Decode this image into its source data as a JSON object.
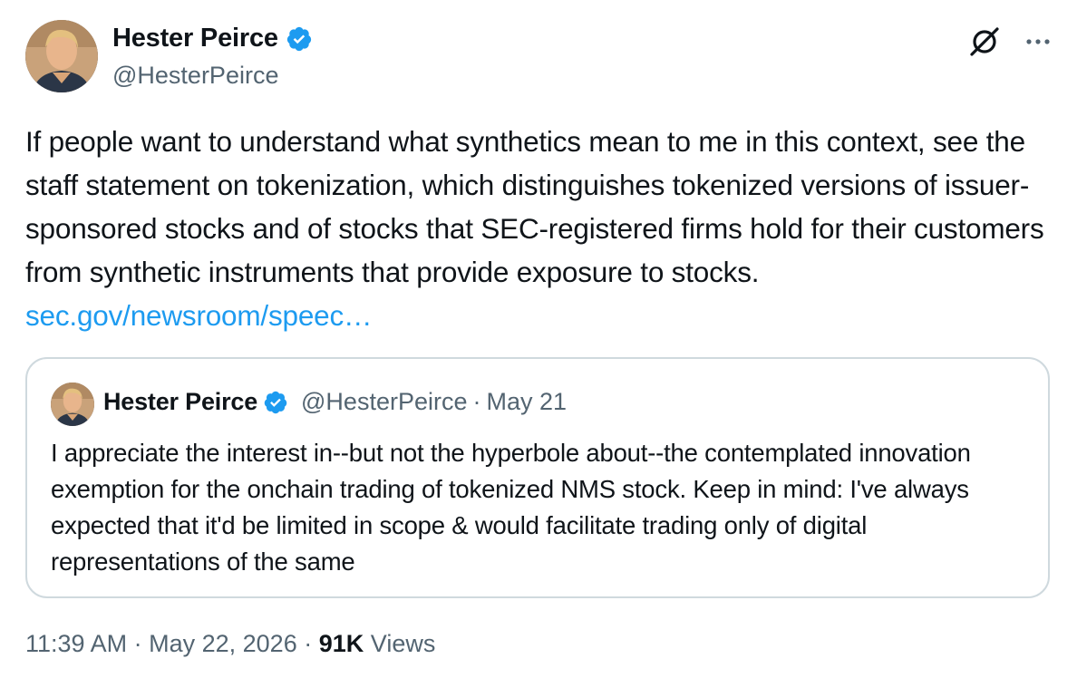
{
  "author": {
    "name": "Hester Peirce",
    "handle": "@HesterPeirce",
    "avatar_icon": "profile-photo",
    "verified_icon": "verified-badge-icon",
    "verified_color": "#1d9bf0"
  },
  "actions": {
    "grok_icon": "grok-icon",
    "more_icon": "more-options-icon"
  },
  "tweet": {
    "text": "If people want to understand what synthetics mean to me in this context, see the staff statement on tokenization, which distinguishes tokenized versions of issuer-sponsored stocks and of stocks that SEC-registered firms hold for their customers from synthetic instruments that provide exposure to stocks. ",
    "link_text": "sec.gov/newsroom/speec…"
  },
  "quoted_tweet": {
    "name": "Hester Peirce",
    "handle": "@HesterPeirce",
    "separator": "·",
    "date": "May 21",
    "text": "I appreciate the interest in--but not the hyperbole about--the contemplated innovation exemption for the onchain trading of tokenized NMS stock. Keep in mind: I've always expected that it'd be limited in scope & would facilitate trading only of digital representations of the same"
  },
  "footer": {
    "time": "11:39 AM",
    "separator": "·",
    "date": "May 22, 2026",
    "views_count": "91K",
    "views_label": "Views"
  },
  "colors": {
    "text": "#0f1419",
    "secondary": "#536471",
    "link": "#1d9bf0",
    "border": "#cfd9de"
  }
}
